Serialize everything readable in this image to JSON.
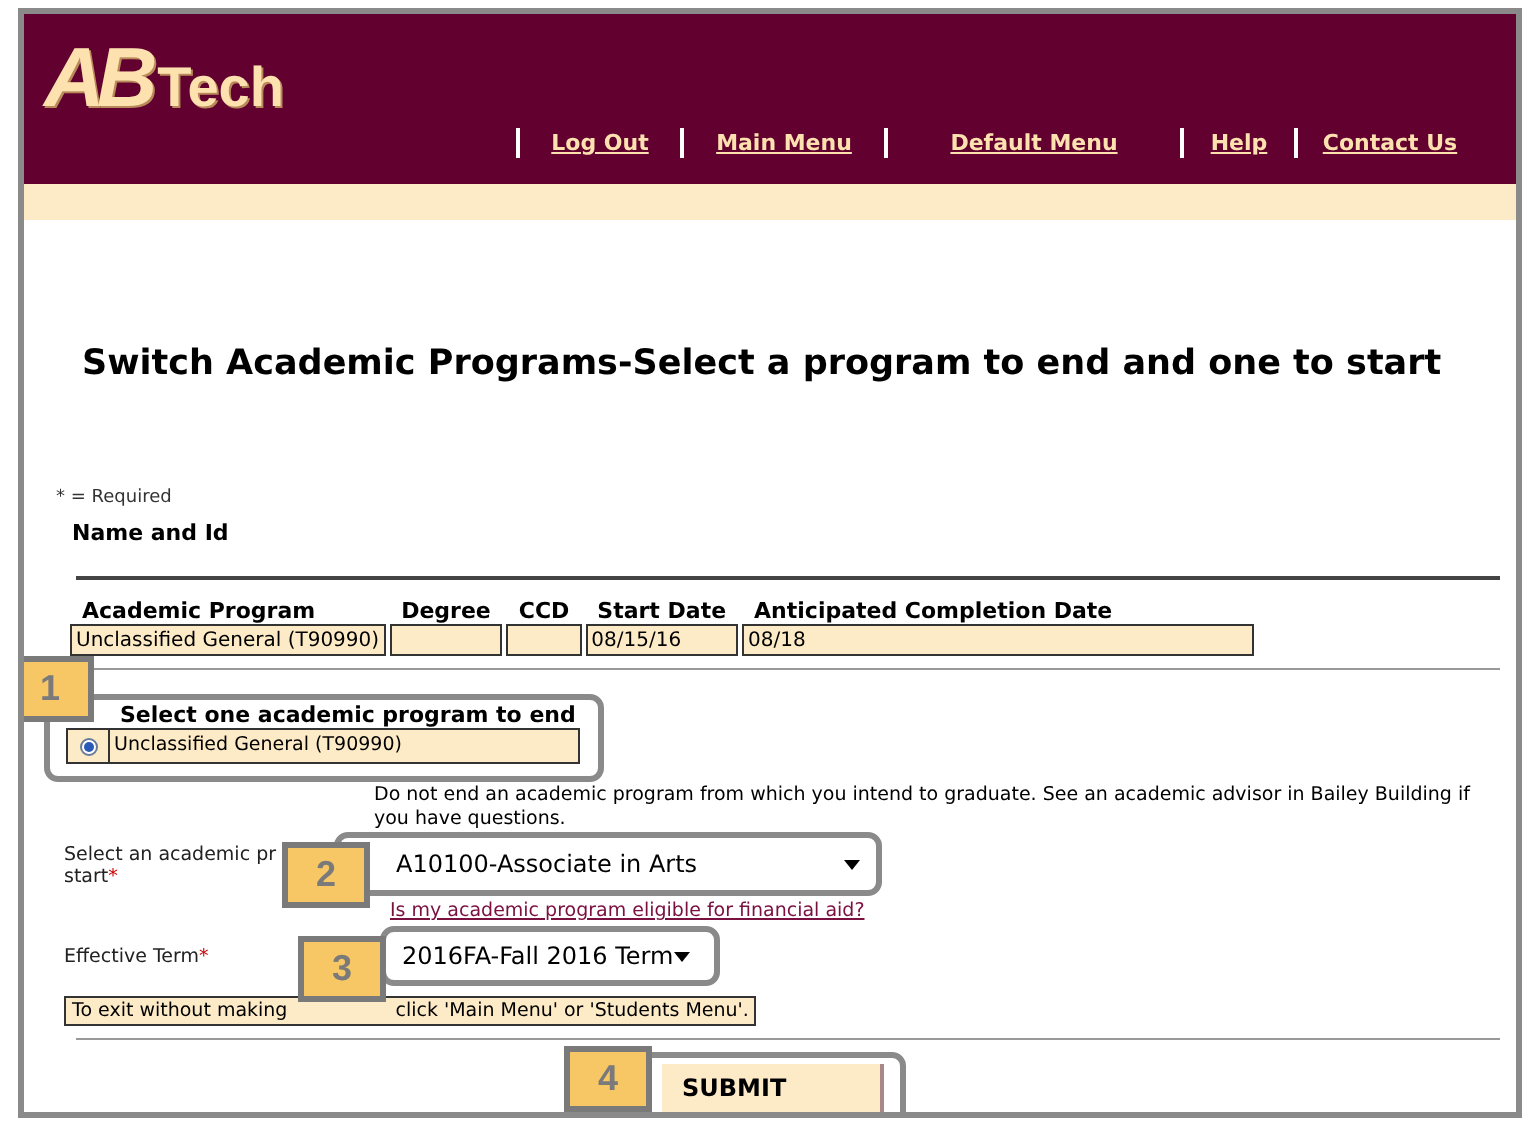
{
  "header": {
    "logo": {
      "mark": "AB",
      "word": "Tech"
    },
    "nav": [
      {
        "label": "Log Out"
      },
      {
        "label": "Main Menu"
      },
      {
        "label": "Default Menu"
      },
      {
        "label": "Help"
      },
      {
        "label": "Contact Us"
      }
    ]
  },
  "title": "Switch Academic Programs-Select a program to end and one to start",
  "required_note": "* = Required",
  "name_and_id": "Name and Id",
  "programs_table": {
    "columns": [
      "Academic Program",
      "Degree",
      "CCD",
      "Start Date",
      "Anticipated Completion Date"
    ],
    "rows": [
      {
        "academic_program": "Unclassified General (T90990)",
        "start_date": "08/15/16",
        "anticipated_completion_date": "08/18"
      }
    ]
  },
  "end_section": {
    "heading": "Select one academic program to end",
    "options": [
      {
        "label": "Unclassified General (T90990)",
        "selected": true
      }
    ]
  },
  "warning": "Do not end an academic program from which you intend to graduate. See an academic advisor in Bailey Building if you have questions.",
  "start_program": {
    "label_start": "Select an academic pr",
    "label_end": "start",
    "marker": "*",
    "value": "A10100-Associate in Arts",
    "aid_link": "Is my academic program eligible for financial aid?"
  },
  "effective_term": {
    "label": "Effective Term",
    "marker": "*",
    "value": "2016FA-Fall 2016 Term"
  },
  "exit_note": {
    "before": "To exit without making",
    "after": "click 'Main Menu' or 'Students Menu'."
  },
  "submit": "SUBMIT",
  "callouts": [
    {
      "number": "1"
    },
    {
      "number": "2"
    },
    {
      "number": "3"
    },
    {
      "number": "4"
    }
  ]
}
